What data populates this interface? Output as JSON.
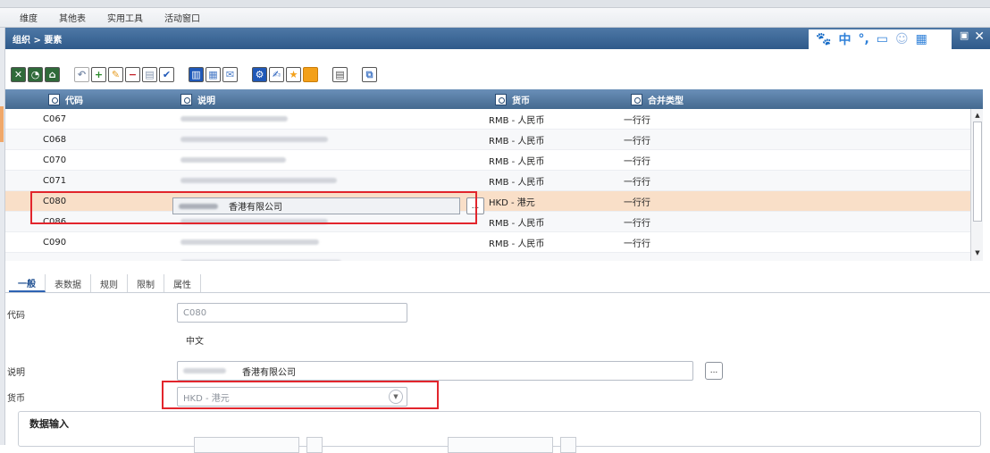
{
  "menu": [
    "维度",
    "其他表",
    "实用工具",
    "活动窗口"
  ],
  "window": {
    "title": "组织 > 要素"
  },
  "ime": {
    "icon": "paw-icon",
    "lang": "中",
    "punct": "°,",
    "items": [
      "ime-keyboard-icon",
      "ime-user-icon",
      "ime-grid-icon"
    ]
  },
  "grid": {
    "columns": [
      "代码",
      "说明",
      "货币",
      "合并类型"
    ],
    "rows": [
      {
        "code": "C067",
        "desc": "",
        "currency": "RMB - 人民币",
        "type": "一行行"
      },
      {
        "code": "C068",
        "desc": "",
        "currency": "RMB - 人民币",
        "type": "一行行"
      },
      {
        "code": "C070",
        "desc": "",
        "currency": "RMB - 人民币",
        "type": "一行行"
      },
      {
        "code": "C071",
        "desc": "",
        "currency": "RMB - 人民币",
        "type": "一行行"
      },
      {
        "code": "C080",
        "desc": "香港有限公司",
        "currency": "HKD - 港元",
        "type": "一行行",
        "selected": true
      },
      {
        "code": "C086",
        "desc": "",
        "currency": "RMB - 人民币",
        "type": "一行行"
      },
      {
        "code": "C090",
        "desc": "",
        "currency": "RMB - 人民币",
        "type": "一行行"
      }
    ],
    "ellipsis": "..."
  },
  "tabs": [
    "一般",
    "表数据",
    "规则",
    "限制",
    "属性"
  ],
  "form": {
    "code_label": "代码",
    "code_value": "C080",
    "lang_label": "中文",
    "desc_label": "说明",
    "desc_value": "香港有限公司",
    "currency_label": "货币",
    "currency_value": "HKD - 港元",
    "section_title": "数据输入",
    "ellipsis": "..."
  },
  "colors": {
    "header": "#44698f",
    "selected_row": "#f9dfc8",
    "highlight": "#e2252c"
  }
}
